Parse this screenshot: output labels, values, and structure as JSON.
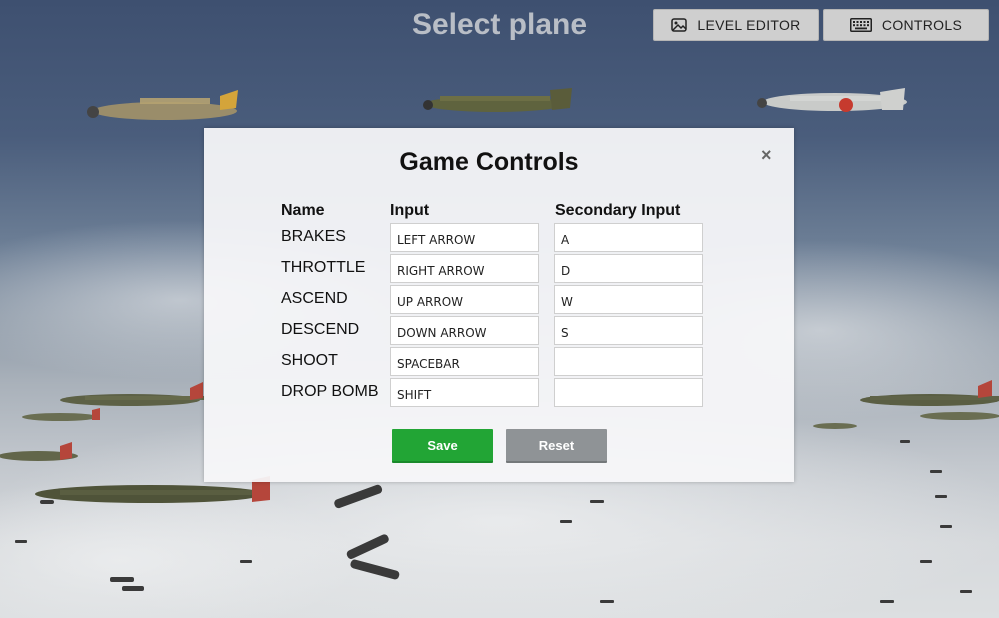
{
  "page": {
    "title": "Select plane"
  },
  "toolbar": {
    "level_editor": {
      "label": "LEVEL EDITOR",
      "icon": "image-icon"
    },
    "controls": {
      "label": "CONTROLS",
      "icon": "keyboard-icon"
    }
  },
  "modal": {
    "title": "Game Controls",
    "close_symbol": "×",
    "headers": {
      "name": "Name",
      "input": "Input",
      "secondary": "Secondary Input"
    },
    "rows": [
      {
        "name": "BRAKES",
        "input": "LEFT ARROW",
        "secondary": "A"
      },
      {
        "name": "THROTTLE",
        "input": "RIGHT ARROW",
        "secondary": "D"
      },
      {
        "name": "ASCEND",
        "input": "UP ARROW",
        "secondary": "W"
      },
      {
        "name": "DESCEND",
        "input": "DOWN ARROW",
        "secondary": "S"
      },
      {
        "name": "SHOOT",
        "input": "SPACEBAR",
        "secondary": ""
      },
      {
        "name": "DROP BOMB",
        "input": "SHIFT",
        "secondary": ""
      }
    ],
    "save_label": "Save",
    "reset_label": "Reset"
  },
  "colors": {
    "save": "#22a535",
    "reset": "#8f9396",
    "backdrop_top": "#3e5070",
    "backdrop_bottom": "#dcdfe1"
  }
}
